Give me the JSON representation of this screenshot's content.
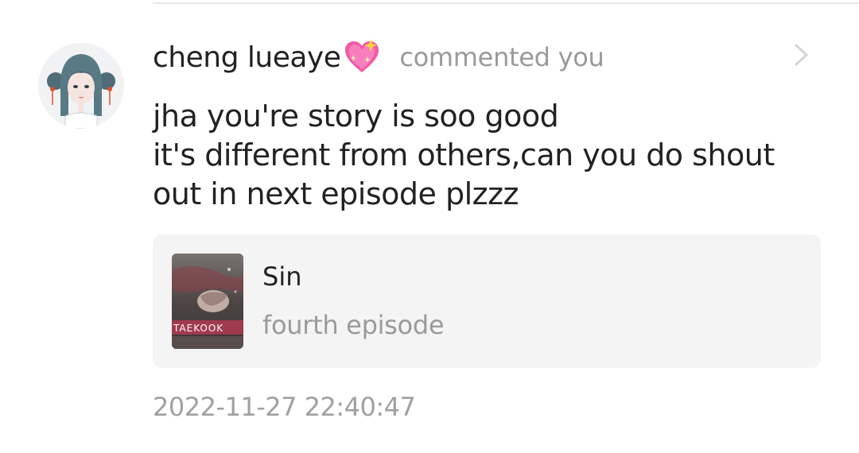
{
  "notification": {
    "user": {
      "name": "cheng lueaye",
      "avatar_icon": "avatar-girl-illustration",
      "name_emoji": "sparkling-heart-icon"
    },
    "action": "commented you",
    "comment_lines": [
      "jha you're story is soo good",
      "it's different from others,can you do shout",
      "out in next episode plzzz"
    ],
    "story": {
      "title": "Sin",
      "episode": "fourth episode",
      "cover_text": "TAEKOOK"
    },
    "timestamp": "2022-11-27 22:40:47",
    "chevron_icon": "chevron-right-icon"
  },
  "colors": {
    "primary_text": "#222222",
    "secondary_text": "#9a9a9a",
    "card_background": "#f4f4f5",
    "divider": "#e8e8e8"
  }
}
